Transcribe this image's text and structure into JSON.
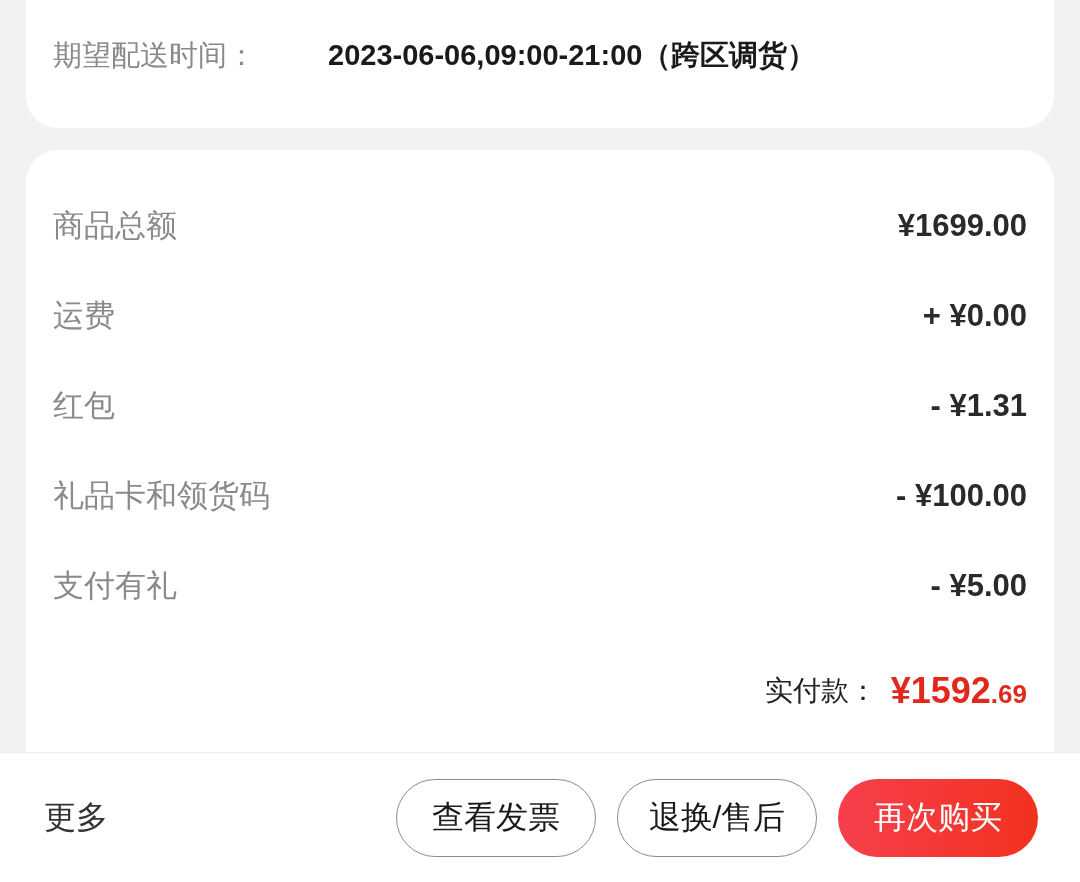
{
  "delivery": {
    "label": "期望配送时间：",
    "value": "2023-06-06,09:00-21:00（跨区调货）"
  },
  "summary": {
    "rows": [
      {
        "label": "商品总额",
        "value": "¥1699.00"
      },
      {
        "label": "运费",
        "value": "+ ¥0.00"
      },
      {
        "label": "红包",
        "value": "- ¥1.31"
      },
      {
        "label": "礼品卡和领货码",
        "value": "- ¥100.00"
      },
      {
        "label": "支付有礼",
        "value": "- ¥5.00"
      }
    ],
    "total": {
      "label": "实付款：",
      "amount": "¥1592",
      "decimals": ".69"
    }
  },
  "bottom_bar": {
    "more": "更多",
    "buttons": [
      {
        "label": "查看发票",
        "kind": "outline"
      },
      {
        "label": "退换/售后",
        "kind": "outline"
      },
      {
        "label": "再次购买",
        "kind": "primary"
      }
    ]
  }
}
